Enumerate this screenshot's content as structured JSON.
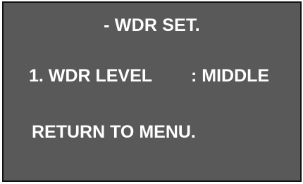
{
  "menu": {
    "title": "- WDR SET.",
    "items": [
      {
        "label": "1. WDR LEVEL",
        "value": ": MIDDLE"
      }
    ],
    "return_label": "RETURN TO MENU."
  },
  "colors": {
    "background": "#595959",
    "text": "#ffffff",
    "border": "#111111"
  }
}
